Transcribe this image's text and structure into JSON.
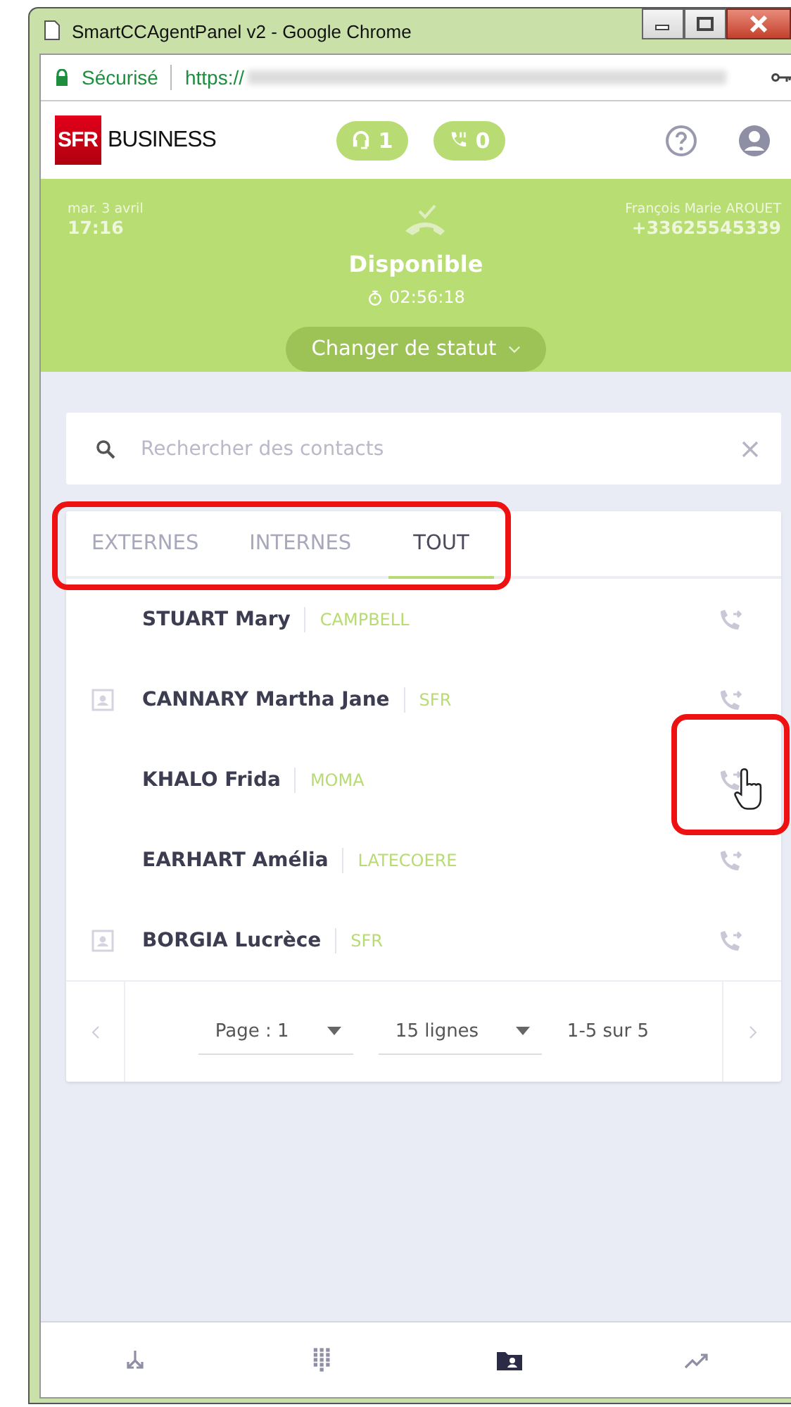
{
  "window": {
    "title": "SmartCCAgentPanel v2 - Google Chrome"
  },
  "address_bar": {
    "security": "Sécurisé",
    "url": "https://"
  },
  "header": {
    "logo": "SFR",
    "brand": "BUSINESS",
    "counters": [
      {
        "kind": "headset",
        "count": "1"
      },
      {
        "kind": "call",
        "count": "0"
      }
    ]
  },
  "status_panel": {
    "date": "mar. 3 avril",
    "time": "17:16",
    "agent": "François Marie AROUET",
    "phone": "+33625545339",
    "status": "Disponible",
    "timer": "02:56:18",
    "button": "Changer de statut"
  },
  "search": {
    "placeholder": "Rechercher des contacts"
  },
  "tabs": {
    "highlighted": true,
    "items": [
      {
        "label": "EXTERNES",
        "selected": false
      },
      {
        "label": "INTERNES",
        "selected": false
      },
      {
        "label": "TOUT",
        "selected": true
      }
    ]
  },
  "contacts": [
    {
      "name": "STUART Mary",
      "company": "CAMPBELL",
      "has_card": false,
      "call_highlighted": false
    },
    {
      "name": "CANNARY Martha Jane",
      "company": "SFR",
      "has_card": true,
      "call_highlighted": false
    },
    {
      "name": "KHALO Frida",
      "company": "MOMA",
      "has_card": false,
      "call_highlighted": true
    },
    {
      "name": "EARHART Amélia",
      "company": "LATECOERE",
      "has_card": false,
      "call_highlighted": false
    },
    {
      "name": "BORGIA Lucrèce",
      "company": "SFR",
      "has_card": true,
      "call_highlighted": false
    }
  ],
  "pagination": {
    "page": "Page : 1",
    "lines": "15 lignes",
    "range": "1-5 sur 5"
  },
  "bottom_nav": [
    {
      "kind": "transfer",
      "selected": false
    },
    {
      "kind": "keypad",
      "selected": false
    },
    {
      "kind": "contacts",
      "selected": true
    },
    {
      "kind": "stats",
      "selected": false
    }
  ]
}
